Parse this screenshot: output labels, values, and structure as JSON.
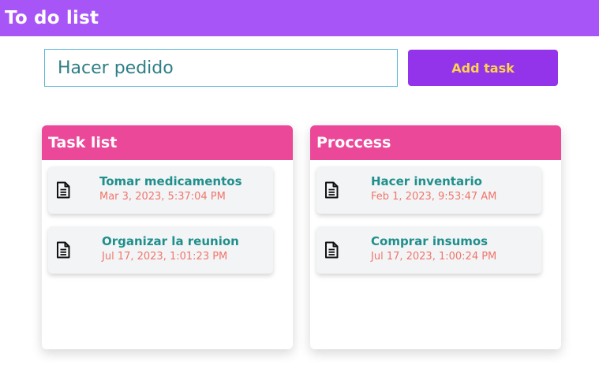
{
  "header": {
    "title": "To do list",
    "background_color": "#a855f7"
  },
  "task_input": {
    "value": "Hacer pedido",
    "placeholder": ""
  },
  "add_button": {
    "label": "Add task",
    "background_color": "#9333ea",
    "text_color": "#fcd34d"
  },
  "columns": [
    {
      "title": "Task list",
      "header_color": "#ec4899",
      "tasks": [
        {
          "name": "Tomar medicamentos",
          "date": "Mar 3, 2023, 5:37:04 PM",
          "icon": "document-icon"
        },
        {
          "name": "Organizar la reunion",
          "date": "Jul 17, 2023, 1:01:23 PM",
          "icon": "document-icon"
        }
      ]
    },
    {
      "title": "Proccess",
      "header_color": "#ec4899",
      "tasks": [
        {
          "name": "Hacer inventario",
          "date": "Feb 1, 2023, 9:53:47 AM",
          "icon": "document-icon"
        },
        {
          "name": "Comprar insumos",
          "date": "Jul 17, 2023, 1:00:24 PM",
          "icon": "document-icon"
        }
      ]
    }
  ]
}
